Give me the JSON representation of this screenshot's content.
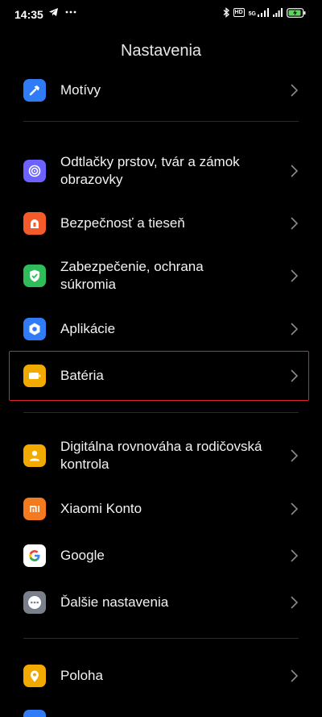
{
  "status_bar": {
    "time": "14:35",
    "net_5g": "5G",
    "net_hd": "HD",
    "battery_color": "#5fd35f"
  },
  "header": {
    "title": "Nastavenia"
  },
  "settings": {
    "items": [
      {
        "label": "Motívy",
        "icon": "brush-icon",
        "color": "#2f7cf6"
      },
      {
        "label": "Odtlačky prstov, tvár a zámok obrazovky",
        "icon": "fingerprint-icon",
        "color": "#6c63ff"
      },
      {
        "label": "Bezpečnosť a tieseň",
        "icon": "emergency-light-icon",
        "color": "#f45a2a"
      },
      {
        "label": "Zabezpečenie, ochrana súkromia",
        "icon": "shield-check-icon",
        "color": "#2ebd59"
      },
      {
        "label": "Aplikácie",
        "icon": "hexagon-gear-icon",
        "color": "#2f7cf6"
      },
      {
        "label": "Batéria",
        "icon": "battery-icon",
        "color": "#f2a900"
      },
      {
        "label": "Digitálna rovnováha a rodičovská kontrola",
        "icon": "person-icon",
        "color": "#f2a900"
      },
      {
        "label": "Xiaomi Konto",
        "icon": "mi-logo-icon",
        "color": "#f47a20"
      },
      {
        "label": "Google",
        "icon": "google-icon",
        "color": "#ffffff"
      },
      {
        "label": "Ďalšie nastavenia",
        "icon": "more-dots-icon",
        "color": "#7a7f8c"
      },
      {
        "label": "Poloha",
        "icon": "location-pin-icon",
        "color": "#f2a900"
      }
    ]
  },
  "highlighted_item": "Batéria"
}
